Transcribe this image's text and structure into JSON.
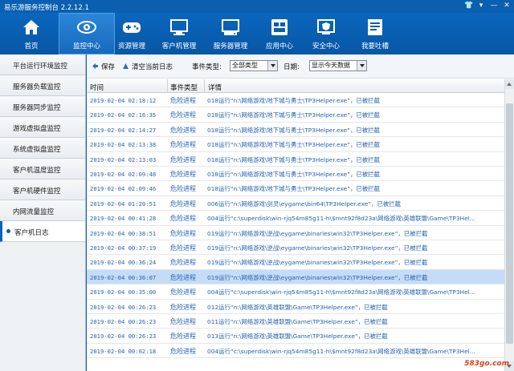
{
  "window": {
    "title": "易乐游服务控制台 2.2.12.1",
    "controls": [
      "👕",
      "▾",
      "—",
      "✕"
    ]
  },
  "nav": {
    "items": [
      {
        "label": "首页",
        "icon": "home-icon"
      },
      {
        "label": "监控中心",
        "icon": "eye-icon",
        "active": true
      },
      {
        "label": "资源管理",
        "icon": "gamepad-icon"
      },
      {
        "label": "客户机管理",
        "icon": "monitor-icon"
      },
      {
        "label": "服务器管理",
        "icon": "server-icon"
      },
      {
        "label": "应用中心",
        "icon": "apps-icon"
      },
      {
        "label": "安全中心",
        "icon": "shield-icon"
      },
      {
        "label": "我要吐槽",
        "icon": "feedback-icon"
      }
    ]
  },
  "sidebar": {
    "items": [
      {
        "label": "平台运行环境监控"
      },
      {
        "label": "服务器负载监控"
      },
      {
        "label": "服务器同步监控"
      },
      {
        "label": "游戏虚拟盘监控"
      },
      {
        "label": "系统虚拟盘监控"
      },
      {
        "label": "客户机温度监控"
      },
      {
        "label": "客户机硬件监控"
      },
      {
        "label": "内网流量监控"
      },
      {
        "label": "客户机日志",
        "active": true
      }
    ]
  },
  "filter": {
    "save_label": "保存",
    "clear_label": "清空当前日志",
    "event_type_label": "事件类型:",
    "event_type_value": "全部类型",
    "date_label": "日期:",
    "date_value": "显示今天数据"
  },
  "table": {
    "headers": {
      "time": "时间",
      "type": "事件类型",
      "detail": "详情"
    },
    "rows": [
      {
        "time": "2019-02-04 02:18:12",
        "type": "危险进程",
        "detail": "018运行“n:\\网络游戏\\地下城与勇士\\TP3Helper.exe”，已被拦截"
      },
      {
        "time": "2019-02-04 02:16:35",
        "type": "危险进程",
        "detail": "018运行“n:\\网络游戏\\地下城与勇士\\TP3Helper.exe”，已被拦截"
      },
      {
        "time": "2019-02-04 02:14:27",
        "type": "危险进程",
        "detail": "018运行“n:\\网络游戏\\地下城与勇士\\TP3Helper.exe”，已被拦截"
      },
      {
        "time": "2019-02-04 02:13:38",
        "type": "危险进程",
        "detail": "018运行“n:\\网络游戏\\地下城与勇士\\TP3Helper.exe”，已被拦截"
      },
      {
        "time": "2019-02-04 02:13:03",
        "type": "危险进程",
        "detail": "018运行“n:\\网络游戏\\地下城与勇士\\TP3Helper.exe”，已被拦截"
      },
      {
        "time": "2019-02-04 02:09:48",
        "type": "危险进程",
        "detail": "018运行“n:\\网络游戏\\地下城与勇士\\TP3Helper.exe”，已被拦截"
      },
      {
        "time": "2019-02-04 02:09:46",
        "type": "危险进程",
        "detail": "018运行“n:\\网络游戏\\地下城与勇士\\TP3Helper.exe”，已被拦截"
      },
      {
        "time": "2019-02-04 01:20:51",
        "type": "危险进程",
        "detail": "006运行“n:\\网络游戏\\剑灵\\eygame\\bin64\\TP3Helper.exe”，已被拦截"
      },
      {
        "time": "2019-02-04 00:41:28",
        "type": "危险进程",
        "detail": "004运行“c:\\superdisk\\win-rjq54m85g11-h\\$mnt92f8d23a\\网络游戏\\英雄联盟\\Game\\TP3Hel..."
      },
      {
        "time": "2019-02-04 00:38:51",
        "type": "危险进程",
        "detail": "019运行“n:\\网络游戏\\逆战\\eygame\\binaries\\win32\\TP3Helper.exe”，已被拦截"
      },
      {
        "time": "2019-02-04 00:37:19",
        "type": "危险进程",
        "detail": "019运行“n:\\网络游戏\\逆战\\eygame\\binaries\\win32\\TP3Helper.exe”，已被拦截"
      },
      {
        "time": "2019-02-04 00:36:24",
        "type": "危险进程",
        "detail": "019运行“n:\\网络游戏\\逆战\\eygame\\binaries\\win32\\TP3Helper.exe”，已被拦截"
      },
      {
        "time": "2019-02-04 00:36:07",
        "type": "危险进程",
        "detail": "019运行“n:\\网络游戏\\逆战\\eygame\\binaries\\win32\\TP3Helper.exe”，已被拦截",
        "selected": true
      },
      {
        "time": "2019-02-04 00:35:00",
        "type": "危险进程",
        "detail": "004运行“c:\\superdisk\\win-rjq54m85g11-h\\$mnt92f8d23a\\网络游戏\\英雄联盟\\Game\\TP3Hel..."
      },
      {
        "time": "2019-02-04 00:26:23",
        "type": "危险进程",
        "detail": "012运行“n:\\网络游戏\\英雄联盟\\Game\\TP3Helper.exe”，已被拦截"
      },
      {
        "time": "2019-02-04 00:26:23",
        "type": "危险进程",
        "detail": "011运行“n:\\网络游戏\\英雄联盟\\Game\\TP3Helper.exe”，已被拦截"
      },
      {
        "time": "2019-02-04 00:26:23",
        "type": "危险进程",
        "detail": "013运行“n:\\网络游戏\\英雄联盟\\Game\\TP3Helper.exe”，已被拦截"
      },
      {
        "time": "2019-02-04 00:02:18",
        "type": "危险进程",
        "detail": "004运行“c:\\superdisk\\win-rjq54m85g11-h\\$mnt92f8d23a\\网络游戏\\英雄联盟\\Game\\TP3Hel..."
      }
    ]
  },
  "watermark": "583go.com",
  "colors": {
    "brand_blue": "#0a63b8",
    "link_blue": "#2563b0",
    "selected_row": "#c4dcf7"
  }
}
